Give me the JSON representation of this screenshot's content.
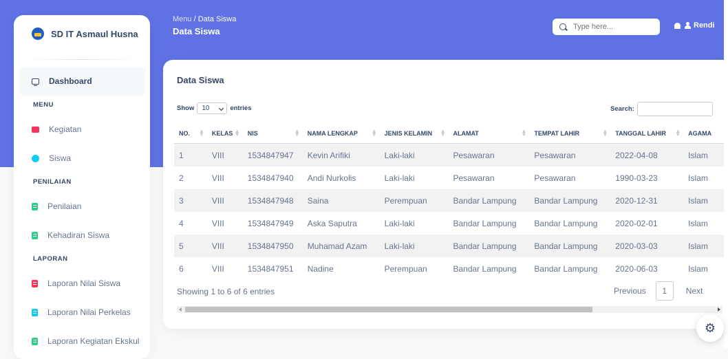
{
  "sidebar": {
    "brand": "SD IT Asmaul Husna",
    "dashboard": "Dashboard",
    "sections": [
      {
        "label": "MENU",
        "items": [
          "Kegiatan",
          "Siswa"
        ]
      },
      {
        "label": "PENILAIAN",
        "items": [
          "Penilaian",
          "Kehadiran Siswa"
        ]
      },
      {
        "label": "LAPORAN",
        "items": [
          "Laporan Nilai Siswa",
          "Laporan Nilai Perkelas",
          "Laporan Kegiatan Ekskul"
        ]
      }
    ]
  },
  "header": {
    "breadcrumb_root": "Menu",
    "breadcrumb_sep": "/",
    "breadcrumb_current": "Data Siswa",
    "title": "Data Siswa",
    "search_placeholder": "Type here...",
    "user": "Rendi"
  },
  "card": {
    "title": "Data Siswa",
    "show_label": "Show",
    "entries_value": "10",
    "entries_label": "entries",
    "search_label": "Search:",
    "columns": [
      "NO.",
      "KELAS",
      "NIS",
      "NAMA LENGKAP",
      "JENIS KELAMIN",
      "ALAMAT",
      "TEMPAT LAHIR",
      "TANGGAL LAHIR",
      "AGAMA"
    ],
    "rows": [
      [
        "1",
        "VIII",
        "1534847947",
        "Kevin Arifiki",
        "Laki-laki",
        "Pesawaran",
        "Pesawaran",
        "2022-04-08",
        "Islam"
      ],
      [
        "2",
        "VIII",
        "1534847940",
        "Andi Nurkolis",
        "Laki-laki",
        "Pesawaran",
        "Pesawaran",
        "1990-03-23",
        "Islam"
      ],
      [
        "3",
        "VIII",
        "1534847948",
        "Saina",
        "Perempuan",
        "Bandar Lampung",
        "Bandar Lampung",
        "2020-12-31",
        "Islam"
      ],
      [
        "4",
        "VIII",
        "1534847949",
        "Aska Saputra",
        "Laki-laki",
        "Bandar Lampung",
        "Bandar Lampung",
        "2020-02-01",
        "Islam"
      ],
      [
        "5",
        "VIII",
        "1534847950",
        "Muhamad Azam",
        "Laki-laki",
        "Bandar Lampung",
        "Bandar Lampung",
        "2020-03-03",
        "Islam"
      ],
      [
        "6",
        "VIII",
        "1534847951",
        "Nadine",
        "Perempuan",
        "Bandar Lampung",
        "Bandar Lampung",
        "2020-06-03",
        "Islam"
      ]
    ],
    "info": "Showing 1 to 6 of 6 entries",
    "pager": {
      "previous": "Previous",
      "page": "1",
      "next": "Next"
    }
  },
  "colors": {
    "primary": "#5e72e4",
    "text": "#344767",
    "muted": "#67748e"
  }
}
